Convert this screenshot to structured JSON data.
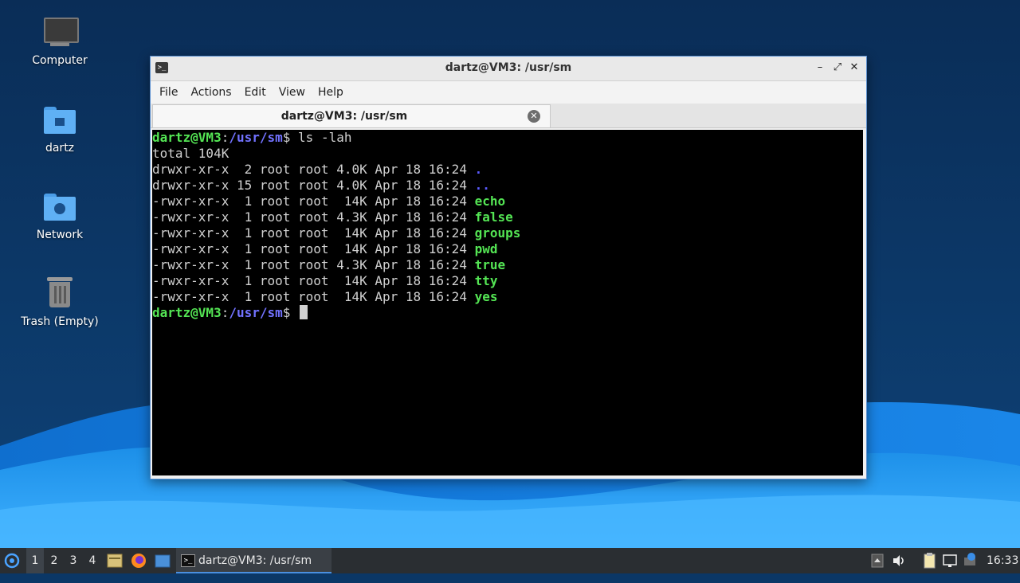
{
  "desktop": {
    "icons": [
      {
        "label": "Computer"
      },
      {
        "label": "dartz"
      },
      {
        "label": "Network"
      },
      {
        "label": "Trash (Empty)"
      }
    ]
  },
  "window": {
    "title": "dartz@VM3: /usr/sm",
    "menu": [
      "File",
      "Actions",
      "Edit",
      "View",
      "Help"
    ],
    "tab_label": "dartz@VM3: /usr/sm"
  },
  "terminal": {
    "prompt_user": "dartz@VM3",
    "prompt_path": "/usr/sm",
    "command": "ls -lah",
    "total": "total 104K",
    "rows": [
      {
        "meta": "drwxr-xr-x  2 root root 4.0K Apr 18 16:24 ",
        "name": ".",
        "kind": "dir"
      },
      {
        "meta": "drwxr-xr-x 15 root root 4.0K Apr 18 16:24 ",
        "name": "..",
        "kind": "dir"
      },
      {
        "meta": "-rwxr-xr-x  1 root root  14K Apr 18 16:24 ",
        "name": "echo",
        "kind": "exec"
      },
      {
        "meta": "-rwxr-xr-x  1 root root 4.3K Apr 18 16:24 ",
        "name": "false",
        "kind": "exec"
      },
      {
        "meta": "-rwxr-xr-x  1 root root  14K Apr 18 16:24 ",
        "name": "groups",
        "kind": "exec"
      },
      {
        "meta": "-rwxr-xr-x  1 root root  14K Apr 18 16:24 ",
        "name": "pwd",
        "kind": "exec"
      },
      {
        "meta": "-rwxr-xr-x  1 root root 4.3K Apr 18 16:24 ",
        "name": "true",
        "kind": "exec"
      },
      {
        "meta": "-rwxr-xr-x  1 root root  14K Apr 18 16:24 ",
        "name": "tty",
        "kind": "exec"
      },
      {
        "meta": "-rwxr-xr-x  1 root root  14K Apr 18 16:24 ",
        "name": "yes",
        "kind": "exec"
      }
    ]
  },
  "taskbar": {
    "workspaces": [
      "1",
      "2",
      "3",
      "4"
    ],
    "active_workspace": "1",
    "task_label": "dartz@VM3: /usr/sm",
    "clock": "16:33"
  },
  "colors": {
    "prompt_user": "#54e554",
    "prompt_path": "#7272ff",
    "executable": "#54e554",
    "directory": "#5a5aff",
    "taskbar_accent": "#4a8fe0"
  }
}
